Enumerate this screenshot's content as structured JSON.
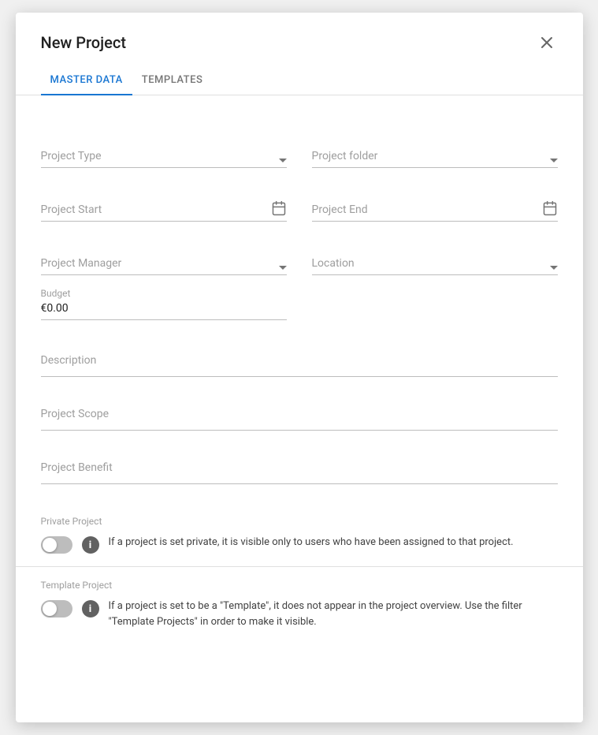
{
  "dialog": {
    "title": "New Project",
    "close_label": "×"
  },
  "tabs": [
    {
      "id": "master-data",
      "label": "MASTER DATA",
      "active": true
    },
    {
      "id": "templates",
      "label": "TEMPLATES",
      "active": false
    }
  ],
  "form": {
    "project_type": {
      "label": "Project Type",
      "placeholder": "Project Type"
    },
    "project_folder": {
      "label": "Project folder",
      "placeholder": "Project folder"
    },
    "project_start": {
      "label": "Project Start",
      "placeholder": "Project Start"
    },
    "project_end": {
      "label": "Project End",
      "placeholder": "Project End"
    },
    "project_manager": {
      "label": "Project Manager",
      "placeholder": "Project Manager"
    },
    "location": {
      "label": "Location",
      "placeholder": "Location"
    },
    "budget": {
      "label": "Budget",
      "value": "€0.00"
    },
    "description": {
      "placeholder": "Description"
    },
    "project_scope": {
      "placeholder": "Project Scope"
    },
    "project_benefit": {
      "placeholder": "Project Benefit"
    }
  },
  "toggles": {
    "private_project": {
      "label": "Private Project",
      "description": "If a project is set private, it is visible only to users who have been assigned to that project.",
      "enabled": false
    },
    "template_project": {
      "label": "Template Project",
      "description": "If a project is set to be a \"Template\", it does not appear in the project overview. Use the filter \"Template Projects\" in order to make it visible.",
      "enabled": false
    }
  }
}
